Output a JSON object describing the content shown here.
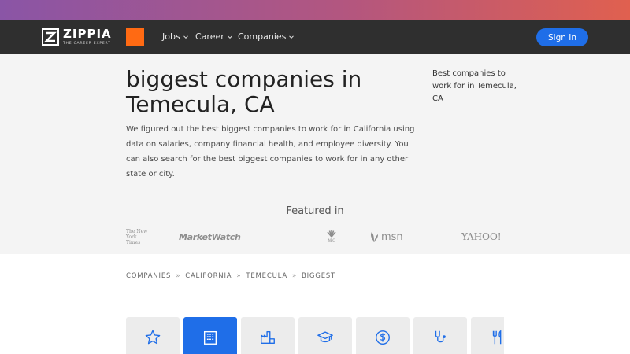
{
  "brand": {
    "name": "ZIPPIA",
    "tagline": "THE CAREER EXPERT"
  },
  "nav": {
    "items": [
      "Jobs",
      "Career",
      "Companies"
    ],
    "signin_label": "Sign In"
  },
  "hero": {
    "title": "biggest companies in Temecula, CA",
    "description": "We figured out the best biggest companies to work for in California using data on salaries, company financial health, and employee diversity. You can also search for the best biggest companies to work for in any other state or city.",
    "side_note": "Best companies to work for in Temecula, CA"
  },
  "featured": {
    "heading": "Featured in",
    "outlets": {
      "nyt": "The New York Times",
      "marketwatch": "MarketWatch",
      "nbc": "NBC",
      "msn": "msn",
      "yahoo": "YAHOO!"
    }
  },
  "breadcrumb": [
    "COMPANIES",
    "CALIFORNIA",
    "TEMECULA",
    "BIGGEST"
  ],
  "categories": [
    {
      "icon": "star-icon",
      "active": false
    },
    {
      "icon": "building-icon",
      "active": true
    },
    {
      "icon": "factory-icon",
      "active": false
    },
    {
      "icon": "graduation-cap-icon",
      "active": false
    },
    {
      "icon": "dollar-icon",
      "active": false
    },
    {
      "icon": "stethoscope-icon",
      "active": false
    },
    {
      "icon": "fork-knife-icon",
      "active": false
    }
  ],
  "colors": {
    "accent": "#1f6ee8",
    "brand_orange": "#ff6a13",
    "navbar": "#2f2f2f"
  }
}
